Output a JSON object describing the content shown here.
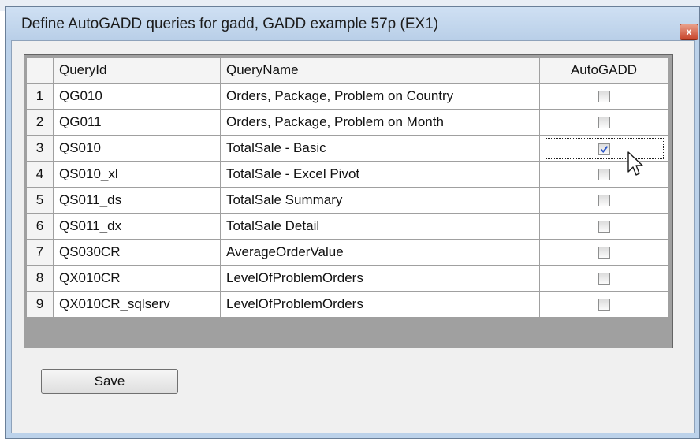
{
  "window": {
    "title": "Define AutoGADD queries for gadd, GADD example 57p (EX1)",
    "close_glyph": "x"
  },
  "grid": {
    "columns": [
      "QueryId",
      "QueryName",
      "AutoGADD"
    ],
    "rows": [
      {
        "num": "1",
        "id": "QG010",
        "name": "Orders, Package, Problem on Country",
        "auto": false
      },
      {
        "num": "2",
        "id": "QG011",
        "name": "Orders, Package, Problem on Month",
        "auto": false
      },
      {
        "num": "3",
        "id": "QS010",
        "name": "TotalSale - Basic",
        "auto": true
      },
      {
        "num": "4",
        "id": "QS010_xl",
        "name": "TotalSale - Excel Pivot",
        "auto": false
      },
      {
        "num": "5",
        "id": "QS011_ds",
        "name": "TotalSale Summary",
        "auto": false
      },
      {
        "num": "6",
        "id": "QS011_dx",
        "name": "TotalSale Detail",
        "auto": false
      },
      {
        "num": "7",
        "id": "QS030CR",
        "name": "AverageOrderValue",
        "auto": false
      },
      {
        "num": "8",
        "id": "QX010CR",
        "name": "LevelOfProblemOrders",
        "auto": false
      },
      {
        "num": "9",
        "id": "QX010CR_sqlserv",
        "name": "LevelOfProblemOrders",
        "auto": false
      }
    ]
  },
  "buttons": {
    "save_label": "Save"
  },
  "icons": {
    "close": "close-icon",
    "cursor": "mouse-pointer-icon",
    "check": "checkmark-icon"
  },
  "colors": {
    "title_bg": "#bcd2ea",
    "check": "#2a55c8",
    "close_bg": "#c8442b"
  }
}
